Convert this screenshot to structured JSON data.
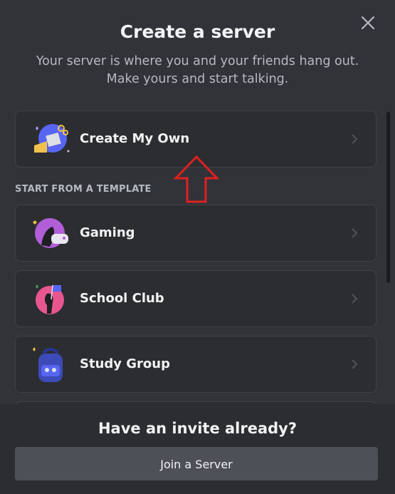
{
  "modal": {
    "title": "Create a server",
    "subtitle": "Your server is where you and your friends hang out. Make yours and start talking."
  },
  "options": {
    "create_own": "Create My Own",
    "section_header": "START FROM A TEMPLATE",
    "templates": [
      {
        "label": "Gaming",
        "icon": "gaming-art-icon"
      },
      {
        "label": "School Club",
        "icon": "school-club-art-icon"
      },
      {
        "label": "Study Group",
        "icon": "study-group-art-icon"
      }
    ]
  },
  "footer": {
    "title": "Have an invite already?",
    "join_label": "Join a Server"
  },
  "colors": {
    "background": "#313338",
    "card": "#2b2d31",
    "button": "#4e5058",
    "annotation_arrow": "#e02020"
  }
}
